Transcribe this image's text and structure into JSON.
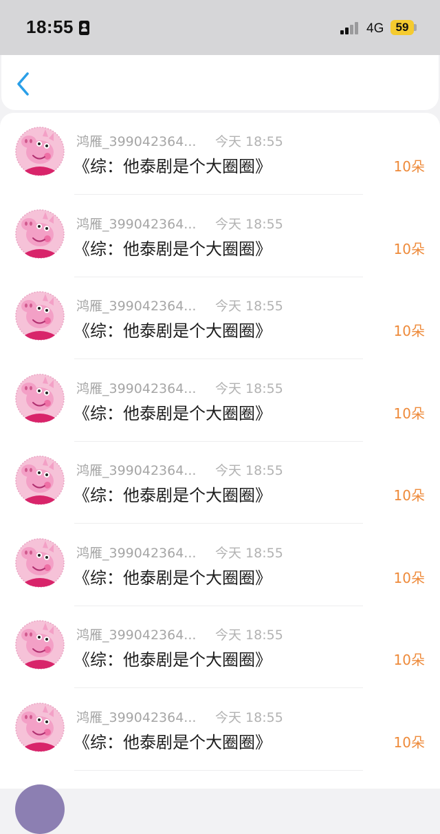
{
  "status_bar": {
    "time": "18:55",
    "network": "4G",
    "battery": "59",
    "battery_color": "#f5cb2f"
  },
  "nav": {
    "back_icon": "chevron-left-icon",
    "accent": "#2a9fe8"
  },
  "records": [
    {
      "name": "鸿雁_399042364...",
      "time": "今天 18:55",
      "book": "《综：他泰剧是个大圈圈》",
      "amount": "10朵"
    },
    {
      "name": "鸿雁_399042364...",
      "time": "今天 18:55",
      "book": "《综：他泰剧是个大圈圈》",
      "amount": "10朵"
    },
    {
      "name": "鸿雁_399042364...",
      "time": "今天 18:55",
      "book": "《综：他泰剧是个大圈圈》",
      "amount": "10朵"
    },
    {
      "name": "鸿雁_399042364...",
      "time": "今天 18:55",
      "book": "《综：他泰剧是个大圈圈》",
      "amount": "10朵"
    },
    {
      "name": "鸿雁_399042364...",
      "time": "今天 18:55",
      "book": "《综：他泰剧是个大圈圈》",
      "amount": "10朵"
    },
    {
      "name": "鸿雁_399042364...",
      "time": "今天 18:55",
      "book": "《综：他泰剧是个大圈圈》",
      "amount": "10朵"
    },
    {
      "name": "鸿雁_399042364...",
      "time": "今天 18:55",
      "book": "《综：他泰剧是个大圈圈》",
      "amount": "10朵"
    },
    {
      "name": "鸿雁_399042364...",
      "time": "今天 18:55",
      "book": "《综：他泰剧是个大圈圈》",
      "amount": "10朵"
    }
  ],
  "colors": {
    "amount": "#ee8a3a",
    "avatar_pink": "#f3a8c8"
  }
}
